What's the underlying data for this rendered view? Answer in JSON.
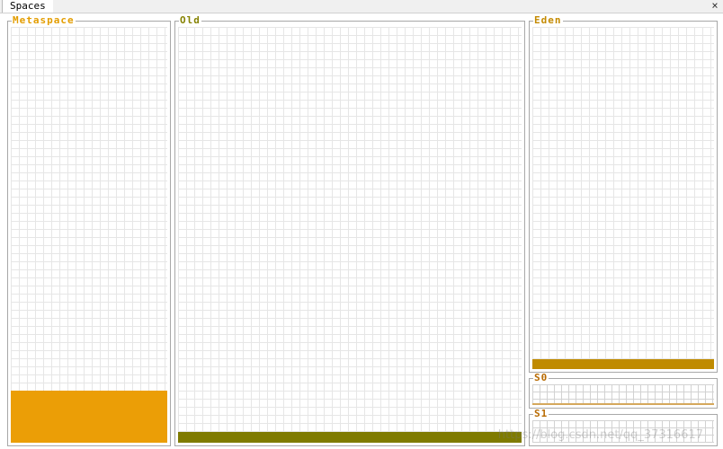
{
  "titlebar": {
    "tab_label": "Spaces",
    "close_glyph": "×"
  },
  "spaces": {
    "metaspace": {
      "label": "Metaspace",
      "label_color": "#e39d00",
      "fill_color": "#eb9e06",
      "fill_fraction": 0.125
    },
    "old": {
      "label": "Old",
      "label_color": "#858202",
      "fill_color": "#7f7b00",
      "fill_fraction": 0.025
    },
    "eden": {
      "label": "Eden",
      "label_color": "#c48a00",
      "fill_color": "#c08b00",
      "fill_fraction": 0.03
    },
    "s0": {
      "label": "S0",
      "label_color": "#b86a00",
      "fill_color": "#d5a85c",
      "fill_fraction": 0.08
    },
    "s1": {
      "label": "S1",
      "label_color": "#b86a00",
      "fill_color": "#d5a85c",
      "fill_fraction": 0.0
    }
  },
  "watermark": "https://blog.csdn.net/qq_37316617"
}
